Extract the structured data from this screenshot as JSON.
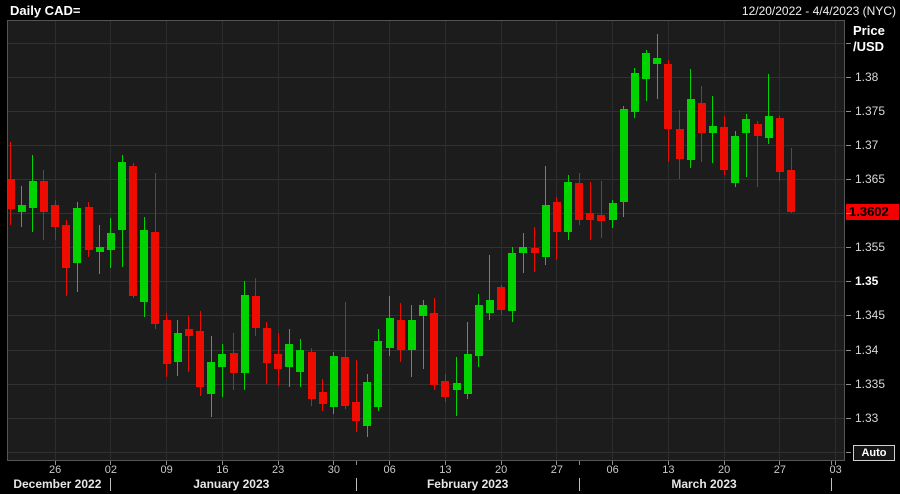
{
  "header": {
    "title": "Daily CAD=",
    "date_range": "12/20/2022 - 4/4/2023 (NYC)"
  },
  "y_axis": {
    "unit_line1": "Price",
    "unit_line2": "/USD",
    "current_price": "1.3602",
    "auto_button": "Auto",
    "grid_prices": [
      1.385,
      1.38,
      1.375,
      1.37,
      1.365,
      1.36,
      1.355,
      1.35,
      1.345,
      1.34,
      1.335,
      1.33,
      1.325
    ],
    "labels": [
      {
        "text": "1.38",
        "price": 1.38,
        "bold": false
      },
      {
        "text": "1.375",
        "price": 1.375,
        "bold": false
      },
      {
        "text": "1.37",
        "price": 1.37,
        "bold": false
      },
      {
        "text": "1.365",
        "price": 1.365,
        "bold": false
      },
      {
        "text": "1.355",
        "price": 1.355,
        "bold": false
      },
      {
        "text": "1.35",
        "price": 1.35,
        "bold": true
      },
      {
        "text": "1.345",
        "price": 1.345,
        "bold": false
      },
      {
        "text": "1.34",
        "price": 1.34,
        "bold": false
      },
      {
        "text": "1.335",
        "price": 1.335,
        "bold": false
      },
      {
        "text": "1.33",
        "price": 1.33,
        "bold": false
      }
    ]
  },
  "x_axis": {
    "ticks": [
      {
        "i": 4,
        "label": "26"
      },
      {
        "i": 9,
        "label": "02"
      },
      {
        "i": 14,
        "label": "09"
      },
      {
        "i": 19,
        "label": "16"
      },
      {
        "i": 24,
        "label": "23"
      },
      {
        "i": 29,
        "label": "30"
      },
      {
        "i": 34,
        "label": "06"
      },
      {
        "i": 39,
        "label": "13"
      },
      {
        "i": 44,
        "label": "20"
      },
      {
        "i": 49,
        "label": "27"
      },
      {
        "i": 54,
        "label": "06"
      },
      {
        "i": 59,
        "label": "13"
      },
      {
        "i": 64,
        "label": "20"
      },
      {
        "i": 69,
        "label": "27"
      },
      {
        "i": 74,
        "label": "03"
      }
    ],
    "separators": [
      9,
      31,
      51,
      73.6
    ],
    "months": [
      {
        "label": "December 2022",
        "center_i": 4.2
      },
      {
        "label": "January 2023",
        "center_i": 19.8
      },
      {
        "label": "February 2023",
        "center_i": 41.0
      },
      {
        "label": "March 2023",
        "center_i": 62.2
      }
    ]
  },
  "chart_data": {
    "type": "candlestick",
    "title": "Daily CAD=",
    "instrument": "CAD=",
    "interval": "Daily",
    "ylabel": "Price /USD",
    "ymin": 1.3238,
    "ymax": 1.3882,
    "grid_on": true,
    "legend_position": "none",
    "colors": {
      "up": "#00d300",
      "down": "#ee0b00",
      "last_price_bg": "#f40000",
      "last_price_text": "#000000"
    },
    "last_close": 1.3602,
    "columns": [
      "date",
      "open",
      "high",
      "low",
      "close"
    ],
    "candles": [
      [
        "2022-12-20",
        1.365,
        1.3704,
        1.3582,
        1.3606
      ],
      [
        "2022-12-21",
        1.3602,
        1.364,
        1.358,
        1.3612
      ],
      [
        "2022-12-22",
        1.3608,
        1.3685,
        1.3573,
        1.3648
      ],
      [
        "2022-12-23",
        1.3648,
        1.3663,
        1.3561,
        1.3602
      ],
      [
        "2022-12-26",
        1.3612,
        1.3619,
        1.3561,
        1.358
      ],
      [
        "2022-12-27",
        1.3583,
        1.359,
        1.3478,
        1.352
      ],
      [
        "2022-12-28",
        1.3527,
        1.3617,
        1.3484,
        1.3608
      ],
      [
        "2022-12-29",
        1.3609,
        1.3616,
        1.3536,
        1.3546
      ],
      [
        "2022-12-30",
        1.3543,
        1.3583,
        1.3511,
        1.3551
      ],
      [
        "2023-01-02",
        1.3546,
        1.3593,
        1.352,
        1.3571
      ],
      [
        "2023-01-03",
        1.3575,
        1.3685,
        1.3521,
        1.3675
      ],
      [
        "2023-01-04",
        1.367,
        1.3673,
        1.3475,
        1.3478
      ],
      [
        "2023-01-05",
        1.347,
        1.3594,
        1.3448,
        1.3575
      ],
      [
        "2023-01-06",
        1.3573,
        1.3659,
        1.343,
        1.3437
      ],
      [
        "2023-01-09",
        1.3444,
        1.3454,
        1.336,
        1.3379
      ],
      [
        "2023-01-10",
        1.3382,
        1.3444,
        1.3361,
        1.3425
      ],
      [
        "2023-01-11",
        1.343,
        1.3449,
        1.3367,
        1.342
      ],
      [
        "2023-01-12",
        1.3427,
        1.3456,
        1.3332,
        1.3345
      ],
      [
        "2023-01-13",
        1.3335,
        1.342,
        1.3301,
        1.3382
      ],
      [
        "2023-01-16",
        1.3374,
        1.3408,
        1.333,
        1.3393
      ],
      [
        "2023-01-17",
        1.3395,
        1.3425,
        1.334,
        1.3365
      ],
      [
        "2023-01-18",
        1.3365,
        1.35,
        1.334,
        1.348
      ],
      [
        "2023-01-19",
        1.3478,
        1.3505,
        1.342,
        1.3432
      ],
      [
        "2023-01-20",
        1.3432,
        1.344,
        1.335,
        1.338
      ],
      [
        "2023-01-23",
        1.3393,
        1.3425,
        1.3346,
        1.3371
      ],
      [
        "2023-01-24",
        1.3374,
        1.343,
        1.3345,
        1.3408
      ],
      [
        "2023-01-25",
        1.3367,
        1.3415,
        1.3345,
        1.34
      ],
      [
        "2023-01-26",
        1.3396,
        1.3403,
        1.3317,
        1.3328
      ],
      [
        "2023-01-27",
        1.3338,
        1.3357,
        1.331,
        1.332
      ],
      [
        "2023-01-30",
        1.3316,
        1.3396,
        1.3306,
        1.339
      ],
      [
        "2023-01-31",
        1.3389,
        1.347,
        1.3313,
        1.3317
      ],
      [
        "2023-02-01",
        1.3323,
        1.3385,
        1.3279,
        1.3295
      ],
      [
        "2023-02-02",
        1.3288,
        1.3364,
        1.3272,
        1.3352
      ],
      [
        "2023-02-03",
        1.3316,
        1.343,
        1.331,
        1.3412
      ],
      [
        "2023-02-06",
        1.3403,
        1.3478,
        1.339,
        1.3447
      ],
      [
        "2023-02-07",
        1.3444,
        1.3469,
        1.3382,
        1.34
      ],
      [
        "2023-02-08",
        1.34,
        1.3466,
        1.336,
        1.3444
      ],
      [
        "2023-02-09",
        1.3449,
        1.3473,
        1.3371,
        1.3466
      ],
      [
        "2023-02-10",
        1.3454,
        1.3476,
        1.3341,
        1.3348
      ],
      [
        "2023-02-13",
        1.3354,
        1.3364,
        1.3323,
        1.333
      ],
      [
        "2023-02-14",
        1.3341,
        1.3389,
        1.3303,
        1.3351
      ],
      [
        "2023-02-15",
        1.3335,
        1.3441,
        1.3328,
        1.3393
      ],
      [
        "2023-02-16",
        1.339,
        1.3481,
        1.3374,
        1.3466
      ],
      [
        "2023-02-17",
        1.3454,
        1.3539,
        1.3444,
        1.3473
      ],
      [
        "2023-02-20",
        1.3492,
        1.3495,
        1.3451,
        1.3458
      ],
      [
        "2023-02-21",
        1.3456,
        1.3551,
        1.3441,
        1.3542
      ],
      [
        "2023-02-22",
        1.3542,
        1.3571,
        1.3513,
        1.3551
      ],
      [
        "2023-02-23",
        1.3549,
        1.358,
        1.3514,
        1.3542
      ],
      [
        "2023-02-24",
        1.3536,
        1.367,
        1.3524,
        1.3612
      ],
      [
        "2023-02-27",
        1.3617,
        1.3624,
        1.3532,
        1.3573
      ],
      [
        "2023-02-28",
        1.3573,
        1.3656,
        1.3561,
        1.3646
      ],
      [
        "2023-03-01",
        1.3645,
        1.3659,
        1.3583,
        1.359
      ],
      [
        "2023-03-02",
        1.3601,
        1.3646,
        1.3561,
        1.359
      ],
      [
        "2023-03-03",
        1.3597,
        1.3648,
        1.3563,
        1.3588
      ],
      [
        "2023-03-06",
        1.359,
        1.362,
        1.3578,
        1.3615
      ],
      [
        "2023-03-07",
        1.3617,
        1.3758,
        1.3594,
        1.3753
      ],
      [
        "2023-03-08",
        1.3748,
        1.3813,
        1.374,
        1.3806
      ],
      [
        "2023-03-09",
        1.3797,
        1.384,
        1.3765,
        1.3835
      ],
      [
        "2023-03-10",
        1.3819,
        1.3863,
        1.3768,
        1.3828
      ],
      [
        "2023-03-13",
        1.3819,
        1.3825,
        1.3675,
        1.3724
      ],
      [
        "2023-03-14",
        1.3724,
        1.3751,
        1.365,
        1.368
      ],
      [
        "2023-03-15",
        1.3678,
        1.3811,
        1.3667,
        1.3768
      ],
      [
        "2023-03-16",
        1.3762,
        1.3787,
        1.3675,
        1.3717
      ],
      [
        "2023-03-17",
        1.3718,
        1.3772,
        1.3673,
        1.3728
      ],
      [
        "2023-03-20",
        1.3726,
        1.3743,
        1.3656,
        1.3663
      ],
      [
        "2023-03-21",
        1.3645,
        1.3721,
        1.3639,
        1.3714
      ],
      [
        "2023-03-22",
        1.3717,
        1.3746,
        1.3653,
        1.3738
      ],
      [
        "2023-03-23",
        1.3731,
        1.3736,
        1.3639,
        1.3714
      ],
      [
        "2023-03-24",
        1.3711,
        1.3804,
        1.3702,
        1.3743
      ],
      [
        "2023-03-27",
        1.374,
        1.3743,
        1.3648,
        1.366
      ],
      [
        "2023-03-28",
        1.3663,
        1.3695,
        1.3601,
        1.3602
      ]
    ]
  }
}
